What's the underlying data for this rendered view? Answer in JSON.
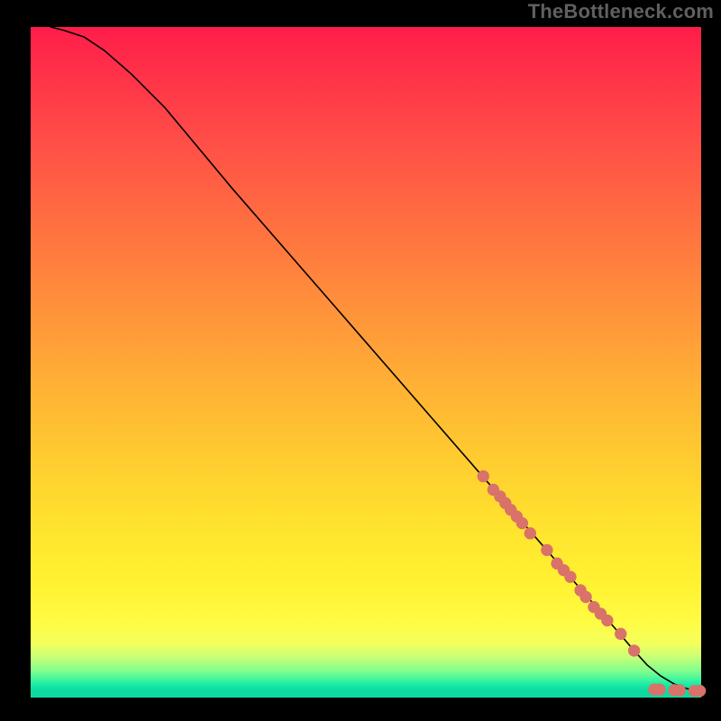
{
  "watermark": "TheBottleneck.com",
  "colors": {
    "black": "#000000",
    "marker": "#d97269",
    "gradient_top": "#ff1d4a",
    "gradient_mid": "#ffe22e",
    "gradient_green": "#0fd9a2"
  },
  "chart_data": {
    "type": "line",
    "title": "",
    "xlabel": "",
    "ylabel": "",
    "xlim": [
      0,
      100
    ],
    "ylim": [
      0,
      100
    ],
    "grid": false,
    "note": "Axis values are not labeled in the image; x/y are normalized 0–100.",
    "series": [
      {
        "name": "curve",
        "x": [
          3,
          5,
          8,
          11,
          15,
          20,
          30,
          40,
          50,
          60,
          70,
          80,
          87,
          90,
          92,
          94,
          96,
          98,
          100
        ],
        "y": [
          100,
          99.5,
          98.5,
          96.5,
          93,
          88,
          76,
          64.5,
          53,
          41.5,
          30,
          18.5,
          10.5,
          7,
          4.8,
          3.2,
          2,
          1.3,
          1
        ]
      }
    ],
    "markers": [
      {
        "x": 67.5,
        "y": 33,
        "r": 1.0
      },
      {
        "x": 69.0,
        "y": 31,
        "r": 1.0
      },
      {
        "x": 70.0,
        "y": 30,
        "r": 1.0
      },
      {
        "x": 70.8,
        "y": 29,
        "r": 1.0
      },
      {
        "x": 71.6,
        "y": 28,
        "r": 1.0
      },
      {
        "x": 72.5,
        "y": 27,
        "r": 1.0
      },
      {
        "x": 73.3,
        "y": 26,
        "r": 1.0
      },
      {
        "x": 74.5,
        "y": 24.5,
        "r": 1.0
      },
      {
        "x": 77.0,
        "y": 22,
        "r": 1.0
      },
      {
        "x": 78.5,
        "y": 20,
        "r": 1.0
      },
      {
        "x": 79.5,
        "y": 19,
        "r": 1.0
      },
      {
        "x": 80.5,
        "y": 18,
        "r": 1.0
      },
      {
        "x": 82.0,
        "y": 16,
        "r": 1.0
      },
      {
        "x": 82.8,
        "y": 15,
        "r": 1.0
      },
      {
        "x": 84.0,
        "y": 13.5,
        "r": 1.0
      },
      {
        "x": 85.0,
        "y": 12.5,
        "r": 1.0
      },
      {
        "x": 86.0,
        "y": 11.5,
        "r": 1.0
      },
      {
        "x": 88.0,
        "y": 9.5,
        "r": 1.0
      },
      {
        "x": 90.0,
        "y": 7,
        "r": 1.0
      },
      {
        "x": 93.0,
        "y": 1.2,
        "r": 1.0
      },
      {
        "x": 93.8,
        "y": 1.2,
        "r": 1.0
      },
      {
        "x": 96.0,
        "y": 1.1,
        "r": 1.0
      },
      {
        "x": 96.8,
        "y": 1.1,
        "r": 1.0
      },
      {
        "x": 99.0,
        "y": 1.0,
        "r": 1.0
      },
      {
        "x": 99.8,
        "y": 1.0,
        "r": 1.0
      }
    ]
  }
}
